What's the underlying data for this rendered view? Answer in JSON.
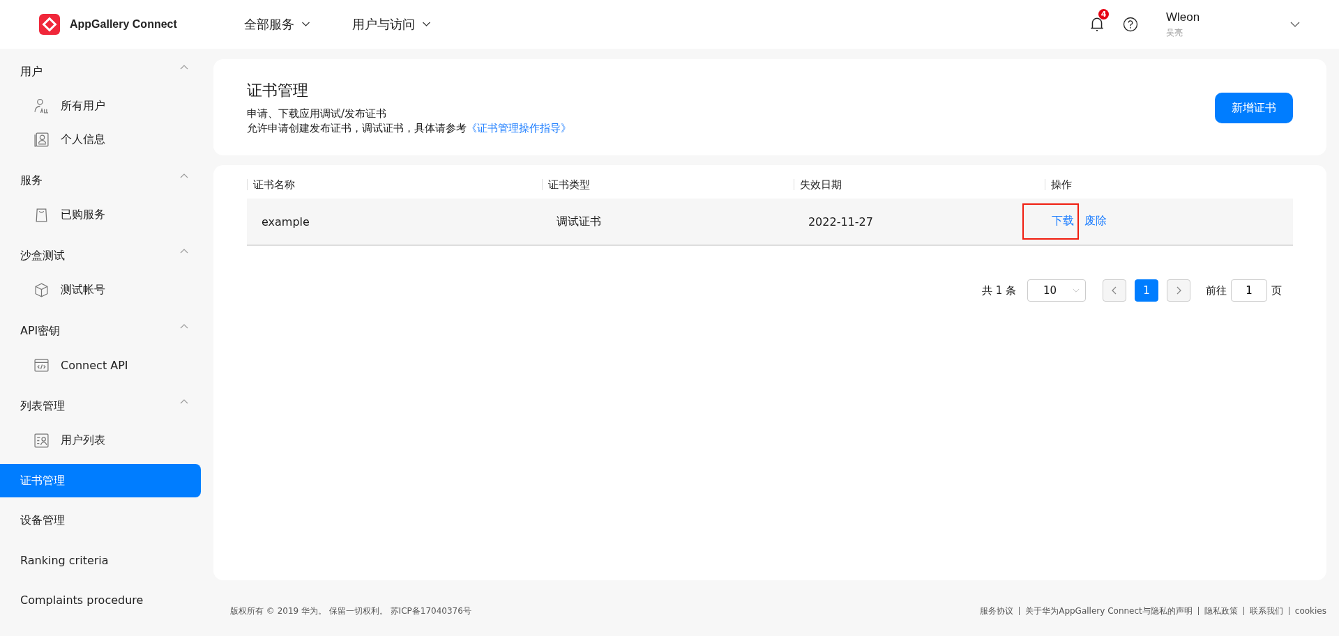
{
  "header": {
    "logo_text": "AppGallery Connect",
    "nav": [
      {
        "label": "全部服务"
      },
      {
        "label": "用户与访问"
      }
    ],
    "notification_count": "4",
    "user": {
      "name": "Wleon",
      "subtitle": "吴亮"
    }
  },
  "sidebar": {
    "groups": [
      {
        "title": "用户",
        "expanded": true,
        "items": [
          {
            "label": "所有用户"
          },
          {
            "label": "个人信息"
          }
        ]
      },
      {
        "title": "服务",
        "expanded": true,
        "items": [
          {
            "label": "已购服务"
          }
        ]
      },
      {
        "title": "沙盒测试",
        "expanded": true,
        "items": [
          {
            "label": "测试帐号"
          }
        ]
      },
      {
        "title": "API密钥",
        "expanded": true,
        "items": [
          {
            "label": "Connect API"
          }
        ]
      },
      {
        "title": "列表管理",
        "expanded": true,
        "items": [
          {
            "label": "用户列表"
          }
        ]
      }
    ],
    "items": [
      {
        "label": "证书管理",
        "selected": true
      },
      {
        "label": "设备管理",
        "selected": false
      },
      {
        "label": "Ranking criteria",
        "selected": false
      },
      {
        "label": "Complaints procedure",
        "selected": false
      }
    ]
  },
  "page": {
    "title": "证书管理",
    "subtitle": "申请、下载应用调试/发布证书",
    "description": "允许申请创建发布证书，调试证书，具体请参考",
    "guide_link": "《证书管理操作指导》",
    "add_button": "新增证书"
  },
  "table": {
    "columns": [
      "证书名称",
      "证书类型",
      "失效日期",
      "操作"
    ],
    "rows": [
      {
        "name": "example",
        "type": "调试证书",
        "expiry": "2022-11-27",
        "actions": [
          {
            "label": "下载",
            "highlighted": true
          },
          {
            "label": "废除",
            "highlighted": false
          }
        ]
      }
    ]
  },
  "pagination": {
    "total": "共 1 条",
    "page_size": "10",
    "pages": [
      {
        "label": "1",
        "selected": true
      }
    ],
    "goto_label": "前往",
    "goto_value": "1",
    "goto_suffix": "页"
  },
  "footer": {
    "copyright": "版权所有 © 2019 华为。 保留一切权利。 苏ICP备17040376号",
    "links": [
      "服务协议",
      "关于华为AppGallery Connect与隐私的声明",
      "隐私政策",
      "联系我们",
      "cookies"
    ]
  }
}
